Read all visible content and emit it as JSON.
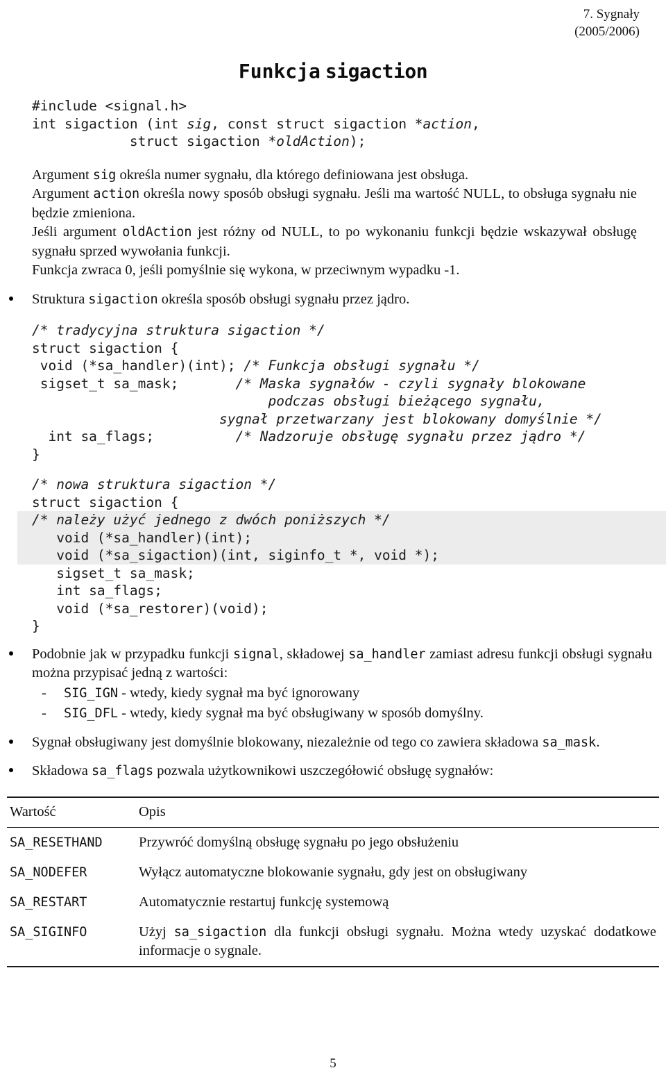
{
  "header": {
    "line1": "7. Sygnały",
    "line2": "(2005/2006)"
  },
  "title": {
    "word1": "Funkcja",
    "word2": "sigaction"
  },
  "prototype": {
    "line1": "#include <signal.h>",
    "line2_a": "int sigaction (int ",
    "line2_i": "sig",
    "line2_b": ", const struct sigaction *",
    "line2_i2": "action",
    "line2_c": ",",
    "line3_a": "            struct sigaction *",
    "line3_i": "oldAction",
    "line3_b": ");"
  },
  "paragraphs": {
    "p1_a": "Argument ",
    "p1_code": "sig",
    "p1_b": " określa numer sygnału, dla  którego definiowana jest obsługa.",
    "p2_a": "Argument ",
    "p2_code": "action",
    "p2_b": " określa nowy sposób obsługi sygnału. Jeśli ma wartość NULL, to obsługa sygnału nie będzie zmieniona.",
    "p3_a": "Jeśli argument ",
    "p3_code": "oldAction",
    "p3_b": " jest różny od NULL, to po wykonaniu funkcji będzie wskazywał obsługę sygnału sprzed wywołania funkcji.",
    "p4": "Funkcja zwraca 0, jeśli pomyślnie się wykona, w przeciwnym wypadku -1."
  },
  "bullets": {
    "struct_intro_a": "Struktura ",
    "struct_intro_code": "sigaction",
    "struct_intro_b": " określa sposób obsługi sygnału przez jądro.",
    "signal_a": "Podobnie jak w przypadku funkcji ",
    "signal_code1": "signal",
    "signal_b": ", składowej ",
    "signal_code2": "sa_handler",
    "signal_c": " zamiast adresu funkcji obsługi sygnału można przypisać jedną z wartości:",
    "blocked_a": "Sygnał obsługiwany jest domyślnie blokowany, niezależnie od tego co zawiera składowa ",
    "blocked_code": "sa_mask",
    "blocked_b": ".",
    "flags_a": "Składowa ",
    "flags_code": "sa_flags",
    "flags_b": " pozwala użytkownikowi uszczegółowić obsługę sygnałów:"
  },
  "dash_items": [
    {
      "dash": "-",
      "code": "SIG_IGN",
      "text": " - wtedy, kiedy sygnał ma być ignorowany"
    },
    {
      "dash": "-",
      "code": "SIG_DFL",
      "text": " - wtedy, kiedy sygnał ma być obsługiwany w sposób domyślny."
    }
  ],
  "code_old": {
    "comment_header": "/* tradycyjna struktura sigaction */",
    "l1": "struct sigaction {",
    "l2_code": " void (*sa_handler)(int); ",
    "l2_cmt": "/* Funkcja obsługi sygnału */",
    "l3_code": " sigset_t sa_mask;       ",
    "l3_cmt": "/* Maska sygnałów - czyli sygnały blokowane",
    "l4_cmt": "                             podczas obsługi bieżącego sygnału,",
    "l5_cmt": "                       sygnał przetwarzany jest blokowany domyślnie */",
    "l6_code": "  int sa_flags;          ",
    "l6_cmt": "/* Nadzoruje obsługę sygnału przez jądro */",
    "l7": "}"
  },
  "code_new": {
    "comment_header": "/* nowa struktura sigaction */",
    "l1": "struct sigaction {",
    "l2_cmt": "/* należy użyć jednego z dwóch poniższych */",
    "l3": "   void (*sa_handler)(int);",
    "l4": "   void (*sa_sigaction)(int, siginfo_t *, void *);",
    "l5": "   sigset_t sa_mask;",
    "l6": "   int sa_flags;",
    "l7": "   void (*sa_restorer)(void);",
    "l8": "}"
  },
  "table": {
    "headers": [
      "Wartość",
      "Opis"
    ],
    "rows": [
      {
        "value": "SA_RESETHAND",
        "desc_a": "Przywróć domyślną obsługę sygnału po jego obsłużeniu",
        "desc_code": "",
        "desc_b": ""
      },
      {
        "value": "SA_NODEFER",
        "desc_a": "Wyłącz automatyczne blokowanie sygnału, gdy jest on obsługiwany",
        "desc_code": "",
        "desc_b": ""
      },
      {
        "value": "SA_RESTART",
        "desc_a": "Automatycznie restartuj funkcję systemową",
        "desc_code": "",
        "desc_b": ""
      },
      {
        "value": "SA_SIGINFO",
        "desc_a": "Użyj ",
        "desc_code": "sa_sigaction",
        "desc_b": " dla funkcji obsługi sygnału. Można wtedy uzyskać dodatkowe informacje o sygnale."
      }
    ]
  },
  "footer": {
    "page_number": "5"
  }
}
